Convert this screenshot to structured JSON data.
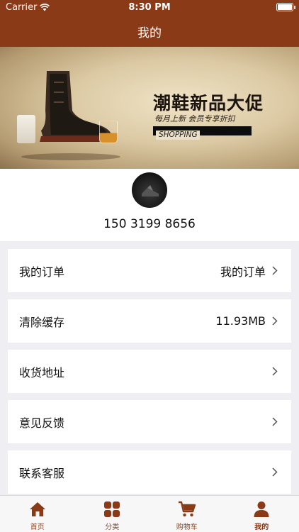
{
  "status_bar": {
    "carrier": "Carrier",
    "time": "8:30 PM"
  },
  "nav": {
    "title": "我的"
  },
  "banner": {
    "headline": "潮鞋新品大促",
    "subline": "每月上新 会员专享折扣",
    "tag": "SHOPPING"
  },
  "profile": {
    "phone": "150 3199 8656"
  },
  "menu": {
    "items": [
      {
        "label": "我的订单",
        "value": "我的订单"
      },
      {
        "label": "清除缓存",
        "value": "11.93MB"
      },
      {
        "label": "收货地址",
        "value": ""
      },
      {
        "label": "意见反馈",
        "value": ""
      },
      {
        "label": "联系客服",
        "value": ""
      }
    ]
  },
  "tabs": [
    {
      "label": "首页",
      "icon": "home-icon"
    },
    {
      "label": "分类",
      "icon": "category-icon"
    },
    {
      "label": "购物车",
      "icon": "cart-icon"
    },
    {
      "label": "我的",
      "icon": "person-icon",
      "active": true
    }
  ],
  "colors": {
    "brand": "#8a3a17",
    "background": "#efeff3"
  }
}
